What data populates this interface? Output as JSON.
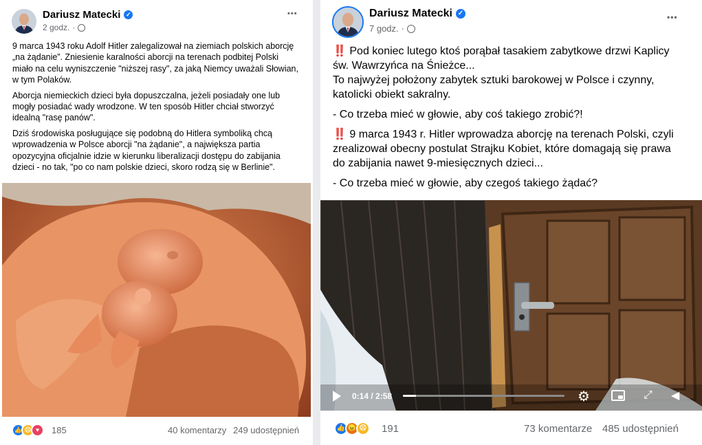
{
  "post_left": {
    "author": "Dariusz Matecki",
    "time": "2 godz.",
    "separator": "·",
    "more": "•••",
    "paragraphs": [
      "9 marca 1943 roku Adolf Hitler zalegalizował na ziemiach polskich aborcję „na żądanie”. Zniesienie karalności aborcji na terenach podbitej Polski miało na celu wyniszczenie \"niższej rasy\", za jaką Niemcy uważali Słowian, w tym Polaków.",
      "Aborcja niemieckich dzieci była dopuszczalna, jeżeli posiadały one lub mogły posiadać wady wrodzone. W ten sposób Hitler chciał stworzyć idealną \"rasę panów\".",
      "Dziś środowiska posługujące się podobną do Hitlera symboliką chcą wprowadzenia w Polsce aborcji \"na żądanie\", a największa partia opozycyjna oficjalnie idzie w kierunku liberalizacji dostępu do zabijania dzieci - no tak, \"po co nam polskie dzieci, skoro rodzą się w Berlinie\"."
    ],
    "image_description_icon": "fetus-in-hand-photo",
    "reactions": [
      "like-icon",
      "sad-icon",
      "love-icon"
    ],
    "reaction_count": "185",
    "comments": "40 komentarzy",
    "shares": "249 udostępnień"
  },
  "post_right": {
    "author": "Dariusz Matecki",
    "time": "7 godz.",
    "separator": "·",
    "more": "•••",
    "bang": "‼️",
    "para1_lines": [
      "Pod koniec lutego ktoś porąbał tasakiem zabytkowe drzwi Kaplicy św. Wawrzyńca na Śnieżce...",
      "To najwyżej położony zabytek sztuki barokowej w Polsce i czynny, katolicki obiekt sakralny."
    ],
    "para2": "- Co trzeba mieć w głowie, aby coś takiego zrobić?!",
    "para3": "9 marca 1943 r. Hitler wprowadza aborcję na terenach Polski, czyli zrealizował obecny postulat Strajku Kobiet, które domagają się prawa do zabijania nawet 9-miesięcznych dzieci...",
    "para4": "- Co trzeba mieć w głowie, aby czegoś takiego żądać?",
    "video": {
      "time": "0:14 / 2:58",
      "progress": 0.08
    },
    "reactions": [
      "like-icon",
      "angry-icon",
      "sad-icon"
    ],
    "reaction_count": "191",
    "comments": "73 komentarze",
    "shares": "485 udostępnień"
  },
  "colors": {
    "accent": "#1877f2",
    "meta": "#65676b",
    "bang": "#e02424"
  }
}
